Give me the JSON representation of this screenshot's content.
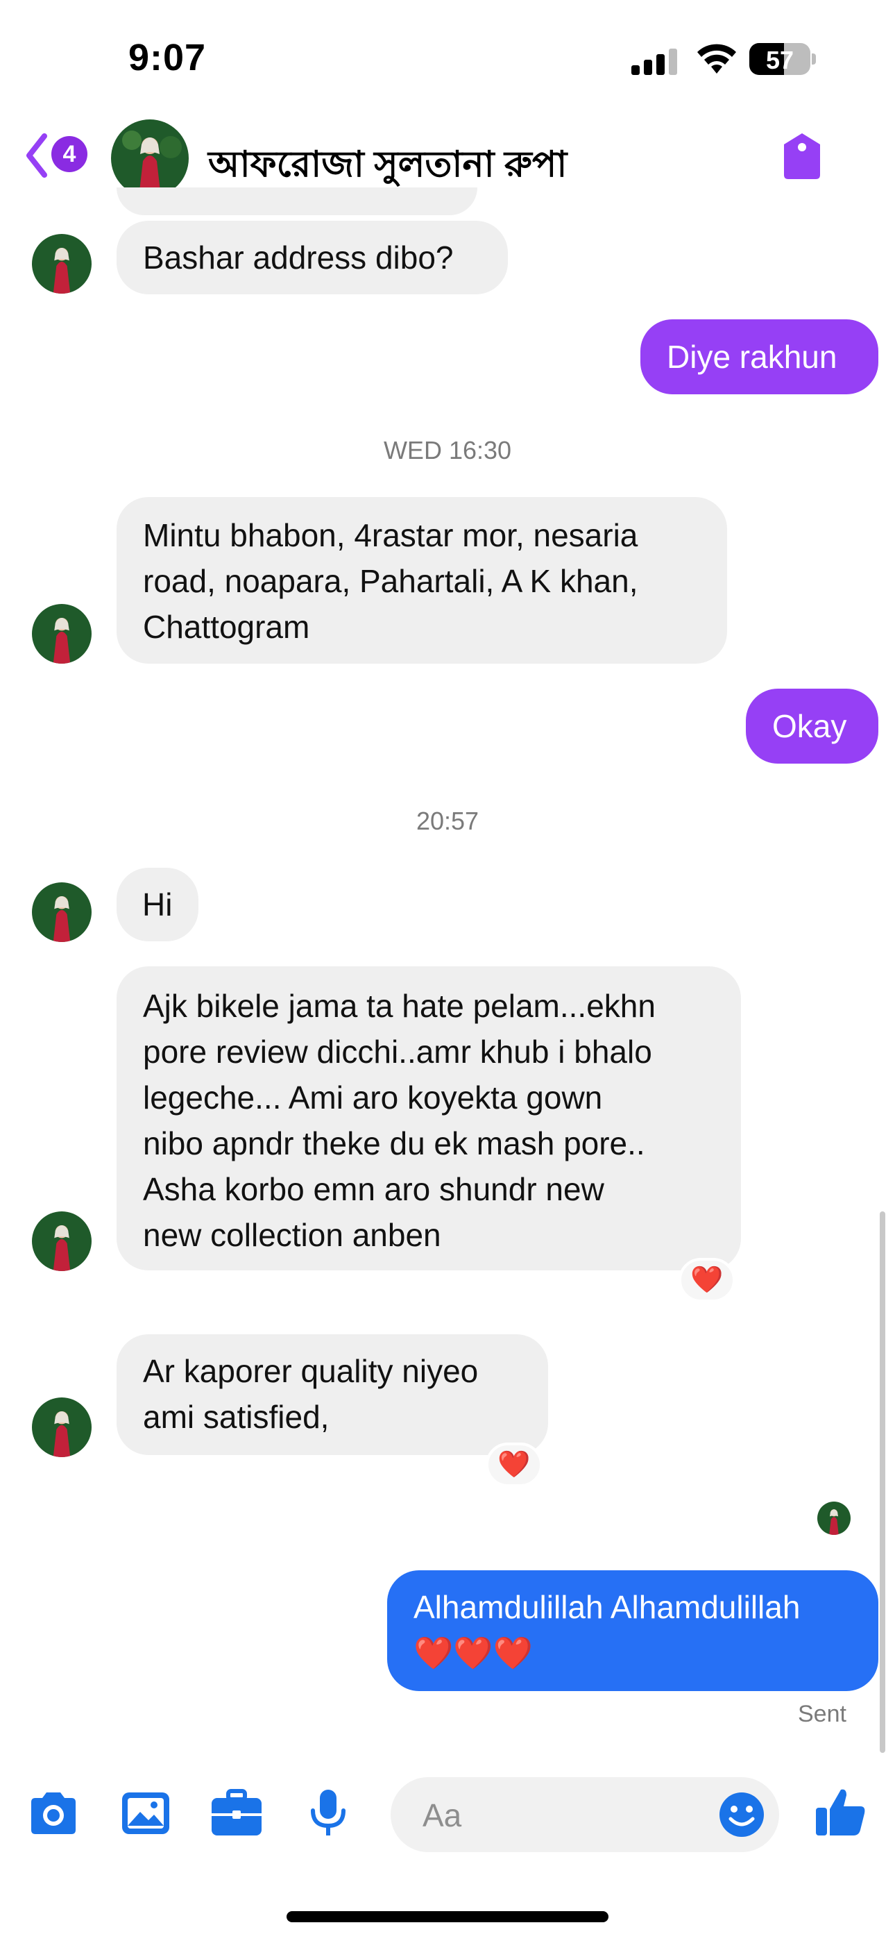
{
  "status_bar": {
    "time": "9:07",
    "battery": "57",
    "battery_level": 0.57
  },
  "header": {
    "back_badge": "4",
    "contact_name": "আফরোজা সুলতানা রুপা"
  },
  "colors": {
    "accent": "#9640f5",
    "sent_blue": "#2670f5",
    "icon_blue": "#1a73e8",
    "incoming_bg": "#efefef"
  },
  "messages": [
    {
      "dir": "in",
      "lines": [
        "Bashar address dibo?"
      ]
    },
    {
      "dir": "out",
      "lines": [
        "Diye rakhun"
      ]
    },
    {
      "timestamp": "WED 16:30"
    },
    {
      "dir": "in",
      "lines": [
        "Mintu bhabon, 4rastar mor, nesaria",
        "road,  noapara, Pahartali, A K khan,",
        "Chattogram"
      ]
    },
    {
      "dir": "out",
      "lines": [
        "Okay"
      ]
    },
    {
      "timestamp": "20:57"
    },
    {
      "dir": "in",
      "lines": [
        "Hi"
      ]
    },
    {
      "dir": "in",
      "lines": [
        "Ajk bikele  jama ta hate pelam...ekhn",
        "pore review dicchi..amr khub i bhalo",
        "legeche...  Ami aro koyekta gown",
        "nibo apndr theke du ek mash pore..",
        "Asha korbo emn aro shundr new",
        "new collection anben"
      ],
      "reaction": "❤️"
    },
    {
      "dir": "in",
      "lines": [
        "Ar kaporer quality niyeo",
        "ami satisfied,"
      ],
      "reaction": "❤️"
    },
    {
      "dir": "out",
      "lines": [
        "Alhamdulillah Alhamdulillah",
        "❤️❤️❤️"
      ]
    }
  ],
  "sent_status": "Sent",
  "composer": {
    "placeholder": "Aa",
    "tools": [
      "camera-icon",
      "gallery-icon",
      "briefcase-icon",
      "microphone-icon"
    ],
    "emoji_icon": "smile-icon",
    "like_icon": "thumbs-up-icon"
  }
}
